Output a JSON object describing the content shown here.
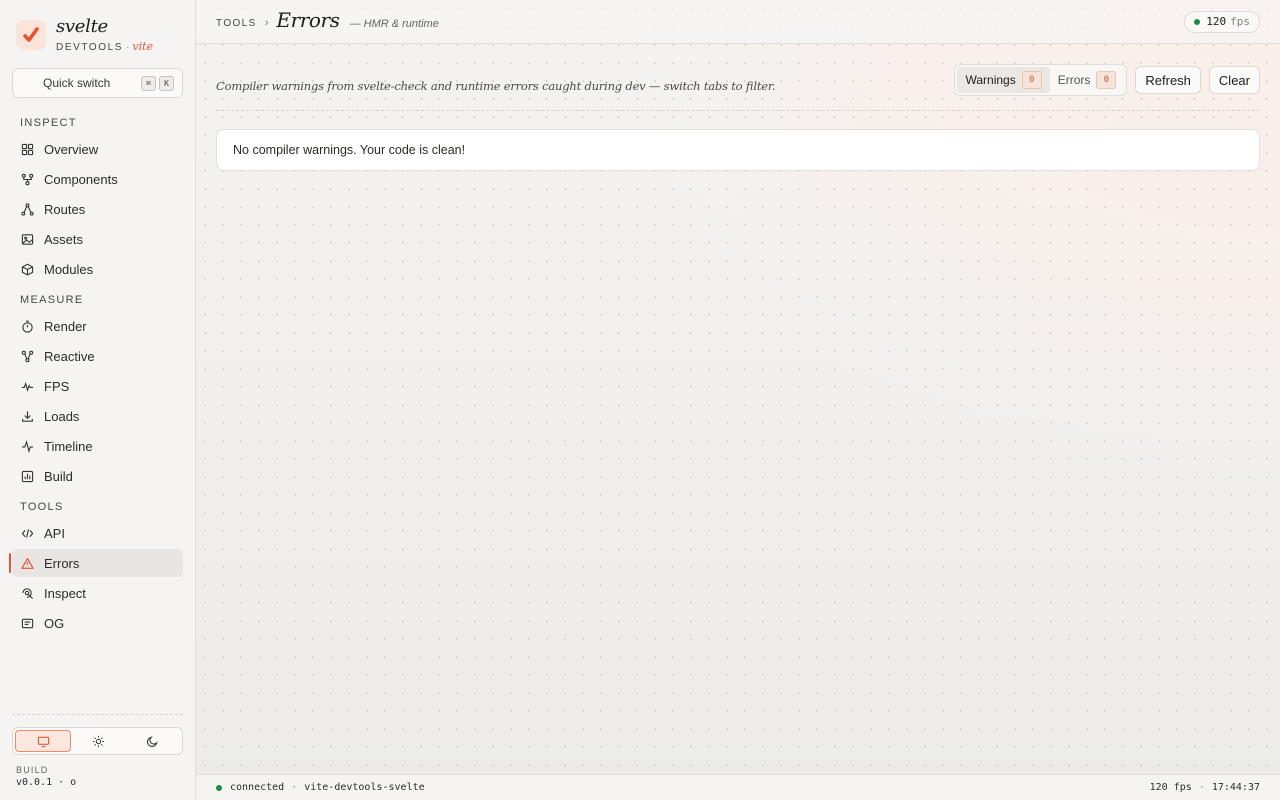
{
  "brand": {
    "name": "svelte",
    "sub": "DEVTOOLS",
    "dot": "·",
    "vite": "vite"
  },
  "quick_switch": {
    "label": "Quick switch",
    "key1": "⌘",
    "key2": "K"
  },
  "sidebar": {
    "sections": [
      {
        "title": "INSPECT",
        "items": [
          "Overview",
          "Components",
          "Routes",
          "Assets",
          "Modules"
        ]
      },
      {
        "title": "MEASURE",
        "items": [
          "Render",
          "Reactive",
          "FPS",
          "Loads",
          "Timeline",
          "Build"
        ]
      },
      {
        "title": "TOOLS",
        "items": [
          "API",
          "Errors",
          "Inspect",
          "OG"
        ]
      }
    ],
    "active_item": "Errors",
    "build_label": "BUILD",
    "build_value": "v0.0.1 · o"
  },
  "header": {
    "section": "TOOLS",
    "separator": "›",
    "title": "Errors",
    "subtitle": "— HMR & runtime",
    "fps_value": "120",
    "fps_unit": "fps"
  },
  "main": {
    "description": "Compiler warnings from svelte-check and runtime errors caught during dev — switch tabs to filter.",
    "tabs": [
      {
        "label": "Warnings",
        "count": "0",
        "active": true
      },
      {
        "label": "Errors",
        "count": "0",
        "active": false
      }
    ],
    "refresh_label": "Refresh",
    "clear_label": "Clear",
    "empty_message": "No compiler warnings. Your code is clean!"
  },
  "status": {
    "state": "connected",
    "sep": "·",
    "project": "vite-devtools-svelte",
    "fps": "120 fps",
    "time": "17:44:37"
  },
  "colors": {
    "accent": "#e2553a",
    "connected": "#1f8a43"
  }
}
